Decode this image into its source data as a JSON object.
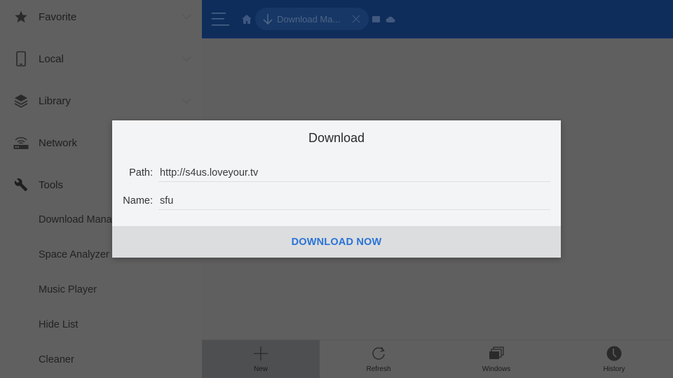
{
  "sidebar": {
    "sections": [
      {
        "label": "Favorite",
        "icon": "star-icon",
        "expandable": true
      },
      {
        "label": "Local",
        "icon": "phone-icon",
        "expandable": true
      },
      {
        "label": "Library",
        "icon": "layers-icon",
        "expandable": true
      },
      {
        "label": "Network",
        "icon": "router-icon",
        "expandable": false
      },
      {
        "label": "Tools",
        "icon": "wrench-icon",
        "expandable": false
      }
    ],
    "tools_items": [
      {
        "label": "Download Manager"
      },
      {
        "label": "Space Analyzer"
      },
      {
        "label": "Music Player"
      },
      {
        "label": "Hide List"
      },
      {
        "label": "Cleaner"
      }
    ]
  },
  "topbar": {
    "menu_icon": "hamburger-icon",
    "home_icon": "home-icon",
    "active_tab": {
      "label": "Download Ma...",
      "icon": "download-arrow-icon"
    },
    "extra_icons": [
      "window-icon",
      "cloud-icon"
    ],
    "color": "#0f2d5a"
  },
  "dialog": {
    "title": "Download",
    "path_label": "Path:",
    "path_value": "http://s4us.loveyour.tv",
    "name_label": "Name:",
    "name_value": "sfu",
    "action_label": "DOWNLOAD NOW",
    "action_color": "#2a73d6"
  },
  "bottombar": {
    "buttons": [
      {
        "label": "New",
        "icon": "plus-icon",
        "active": true
      },
      {
        "label": "Refresh",
        "icon": "refresh-icon",
        "active": false
      },
      {
        "label": "Windows",
        "icon": "windows-stack-icon",
        "active": false
      },
      {
        "label": "History",
        "icon": "clock-icon",
        "active": false
      }
    ]
  }
}
